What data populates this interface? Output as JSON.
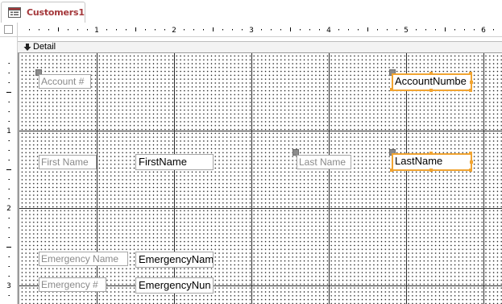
{
  "tab": {
    "label": "Customers1"
  },
  "ruler": {
    "horizontal_marks": [
      "1",
      "2",
      "3",
      "4",
      "5",
      "6"
    ],
    "vertical_marks": [
      "1",
      "2",
      "3"
    ]
  },
  "section": {
    "label": "Detail"
  },
  "controls": {
    "account_label": "Account #",
    "account_field": "AccountNumbe",
    "first_name_label": "First Name",
    "first_name_field": "FirstName",
    "last_name_label": "Last Name",
    "last_name_field": "LastName",
    "emergency_name_label": "Emergency Name",
    "emergency_name_field": "EmergencyNam",
    "emergency_num_label": "Emergency #",
    "emergency_num_field": "EmergencyNun"
  },
  "colors": {
    "tab_text": "#a4373a",
    "selection": "#f1a431",
    "label_text": "#8a8a8a",
    "grid_line": "#2b2b2b"
  },
  "icons": {
    "tab": "form-icon",
    "section": "section-arrow-icon",
    "ruler_corner": "form-selector-icon"
  }
}
